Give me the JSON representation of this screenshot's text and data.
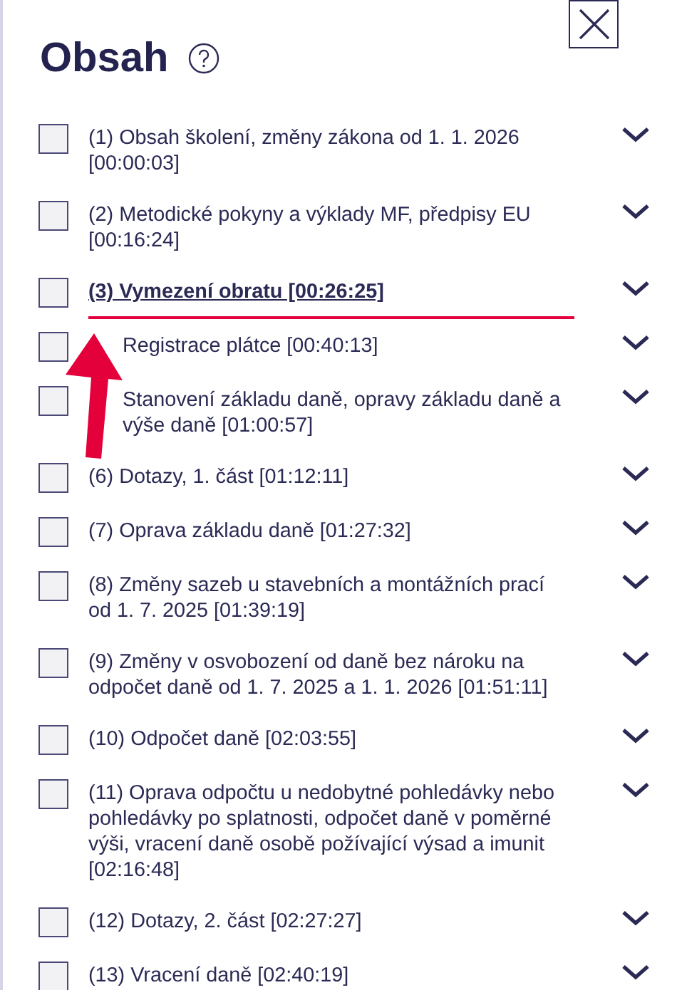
{
  "title": "Obsah",
  "items": [
    {
      "text": "(1) Obsah školení, změny zákona od 1. 1. 2026 [00:00:03]",
      "checked": false,
      "current": false,
      "covered": false
    },
    {
      "text": "(2) Metodické pokyny a výklady MF, předpisy EU [00:16:24]",
      "checked": false,
      "current": false,
      "covered": false
    },
    {
      "text": "(3) Vymezení obratu [00:26:25]",
      "checked": false,
      "current": true,
      "covered": false
    },
    {
      "text": "Registrace plátce [00:40:13]",
      "checked": false,
      "current": false,
      "covered": true
    },
    {
      "text": "Stanovení základu daně, opravy základu daně a výše daně [01:00:57]",
      "checked": false,
      "current": false,
      "covered": true
    },
    {
      "text": "(6) Dotazy, 1. část [01:12:11]",
      "checked": false,
      "current": false,
      "covered": false
    },
    {
      "text": "(7) Oprava základu daně [01:27:32]",
      "checked": false,
      "current": false,
      "covered": false
    },
    {
      "text": "(8) Změny sazeb u stavebních a montážních prací od 1. 7. 2025 [01:39:19]",
      "checked": false,
      "current": false,
      "covered": false
    },
    {
      "text": "(9) Změny v osvobození od daně bez nároku na odpočet daně od 1. 7. 2025 a 1. 1. 2026 [01:51:11]",
      "checked": false,
      "current": false,
      "covered": false
    },
    {
      "text": "(10) Odpočet daně [02:03:55]",
      "checked": false,
      "current": false,
      "covered": false
    },
    {
      "text": "(11) Oprava odpočtu u nedobytné pohledávky nebo pohledávky po splatnosti, odpočet daně v poměrné výši, vracení daně osobě požívající výsad a imunit [02:16:48]",
      "checked": false,
      "current": false,
      "covered": false
    },
    {
      "text": "(12) Dotazy, 2. část [02:27:27]",
      "checked": false,
      "current": false,
      "covered": false
    },
    {
      "text": "(13) Vracení daně [02:40:19]",
      "checked": false,
      "current": false,
      "covered": false
    }
  ]
}
